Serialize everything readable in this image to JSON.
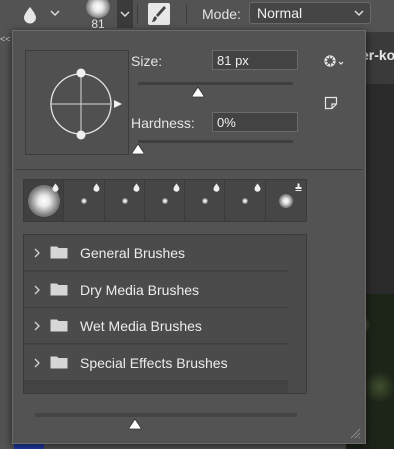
{
  "options_bar": {
    "tool_icon": "water-drop-icon",
    "brush_size_value": "81",
    "brush_settings_icon": "brush-settings-icon",
    "mode_label": "Mode:",
    "mode_value": "Normal"
  },
  "background": {
    "document_tab_fragment": "er-ko",
    "left_collapse_glyph": "<<"
  },
  "brush_picker": {
    "size_label": "Size:",
    "size_value": "81 px",
    "size_slider_level": 0.39,
    "hardness_label": "Hardness:",
    "hardness_value": "0%",
    "hardness_slider_level": 0.0,
    "settings_icon": "gear-icon",
    "new_preset_icon": "new-preset-icon",
    "recent_brushes": [
      {
        "kind": "soft-round-large",
        "selected": true,
        "icon": "water-drop-icon"
      },
      {
        "kind": "soft-round-small",
        "selected": false,
        "icon": "water-drop-icon"
      },
      {
        "kind": "soft-round-small",
        "selected": false,
        "icon": "water-drop-icon"
      },
      {
        "kind": "soft-round-small",
        "selected": false,
        "icon": "water-drop-icon"
      },
      {
        "kind": "soft-round-small",
        "selected": false,
        "icon": "water-drop-icon"
      },
      {
        "kind": "soft-round-small",
        "selected": false,
        "icon": "water-drop-icon"
      },
      {
        "kind": "soft-round-medium",
        "selected": false,
        "icon": "stamp-icon"
      }
    ],
    "brush_groups": [
      {
        "label": "General Brushes"
      },
      {
        "label": "Dry Media Brushes"
      },
      {
        "label": "Wet Media Brushes"
      },
      {
        "label": "Special Effects Brushes"
      }
    ],
    "preview_size_slider_level": 0.38
  }
}
